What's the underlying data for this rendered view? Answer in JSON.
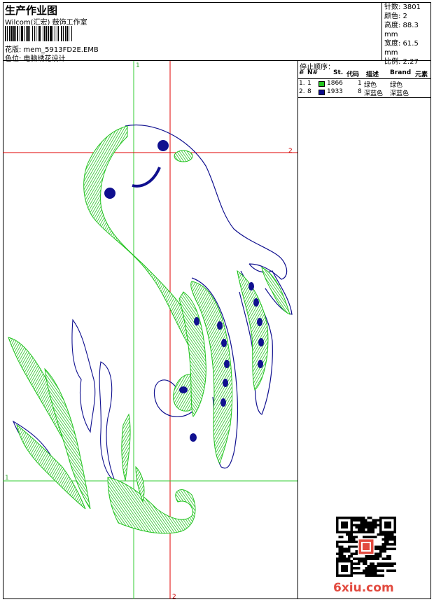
{
  "header": {
    "title": "生产作业图",
    "company": "Wilcom(汇宏) 鼓饰工作室",
    "design_label": "花版: mem_5913FD2E.EMB",
    "color_position_label": "色位: 电脑绣花设计"
  },
  "info": {
    "stitches": "针数: 3801",
    "colors": "颜色: 2",
    "height": "高度: 88.3 mm",
    "width": "宽度: 61.5 mm",
    "ratio": "比例: 2.27"
  },
  "stop_sequence": {
    "title": "停止顺序：",
    "headers": {
      "hash": "#",
      "no": "N#",
      "st": "St.",
      "code": "代码",
      "desc": "描述",
      "brand": "Brand",
      "elem": "元素"
    },
    "rows": [
      {
        "index": "1.",
        "no": "1",
        "code": "1866",
        "st": "1",
        "desc": "绿色",
        "brand": "绿色",
        "color": "#22c31f"
      },
      {
        "index": "2.",
        "no": "8",
        "code": "1933",
        "st": "8",
        "desc": "深蓝色",
        "brand": "深蓝色",
        "color": "#0a0a8c"
      }
    ]
  },
  "guides": {
    "v1": "1",
    "h2": "2",
    "h1": "1",
    "v2": "2"
  },
  "thread_colors": {
    "green": "#22c31f",
    "blue": "#10108f",
    "red": "#e00000",
    "guide_green": "#33cc33"
  },
  "watermark": "6xiu.com"
}
